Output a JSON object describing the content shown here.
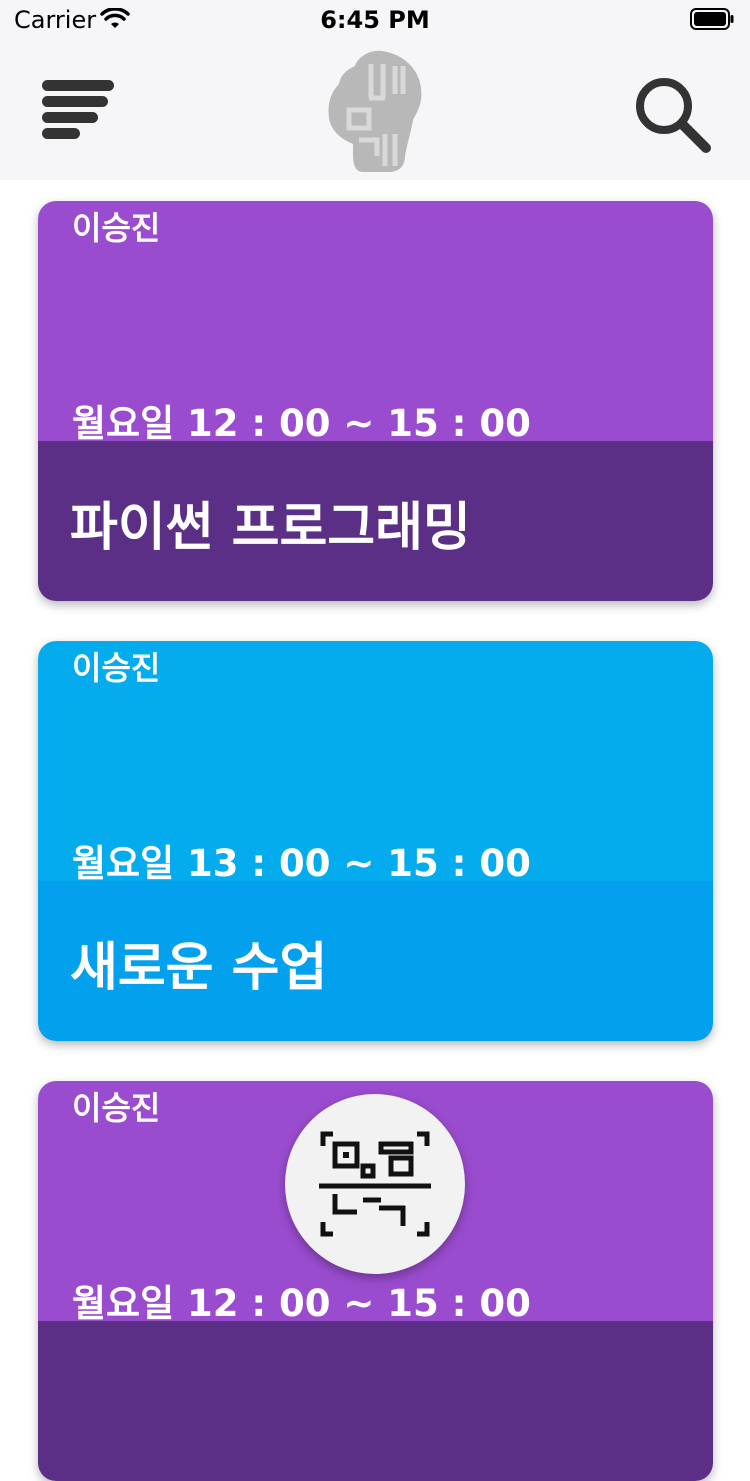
{
  "status_bar": {
    "carrier": "Carrier",
    "time": "6:45 PM"
  },
  "navbar": {
    "menu_icon": "hamburger-menu-icon",
    "logo_icon": "brain-logo-icon",
    "search_icon": "search-icon"
  },
  "courses": [
    {
      "professor": "이승진",
      "time": "월요일 12 : 00 ~ 15 : 00",
      "title": "파이썬 프로그래밍",
      "top_color": "#9a4ccf",
      "bottom_color": "#5b2f86"
    },
    {
      "professor": "이승진",
      "time": "월요일 13 : 00 ~ 15 : 00",
      "title": "새로운 수업",
      "top_color": "#04acee",
      "bottom_color": "#03a0ee"
    },
    {
      "professor": "이승진",
      "time": "월요일 12 : 00 ~ 15 : 00",
      "title": "",
      "top_color": "#9a4ccf",
      "bottom_color": "#5b2f86"
    }
  ],
  "qr_button": {
    "icon": "qr-scan-icon"
  }
}
